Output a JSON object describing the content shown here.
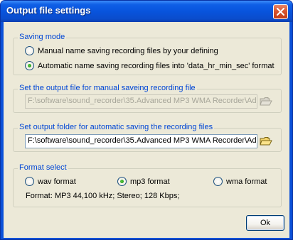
{
  "window": {
    "title": "Output file settings"
  },
  "saving_mode": {
    "title": "Saving mode",
    "options": [
      {
        "label": "Manual name saving recording files by your defining",
        "checked": false
      },
      {
        "label": "Automatic name saving recording files into 'data_hr_min_sec' format",
        "checked": true
      }
    ]
  },
  "manual_output": {
    "title": "Set the output file for manual saveing recording file",
    "path": "F:\\software\\sound_recorder\\35.Advanced MP3 WMA Recorder\\Ad",
    "enabled": false
  },
  "auto_output": {
    "title": "Set output folder for automatic saving the recording files",
    "path": "F:\\software\\sound_recorder\\35.Advanced MP3 WMA Recorder\\Ad",
    "enabled": true
  },
  "format_select": {
    "title": "Format select",
    "options": [
      {
        "label": "wav format",
        "checked": false
      },
      {
        "label": "mp3 format",
        "checked": true
      },
      {
        "label": "wma format",
        "checked": false
      }
    ],
    "info": "Format: MP3 44,100 kHz; Stereo;  128 Kbps;"
  },
  "buttons": {
    "ok": "Ok"
  },
  "colors": {
    "title_bar": "#0a50d8",
    "group_title": "#0046d5",
    "dialog_bg": "#ece9d8",
    "close_button": "#d9552f"
  }
}
